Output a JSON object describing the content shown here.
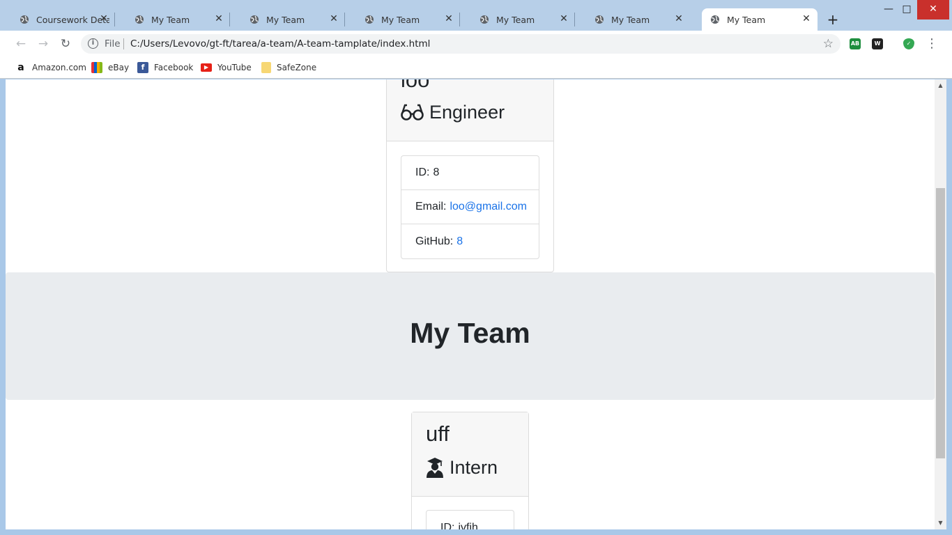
{
  "browser": {
    "tabs": [
      {
        "title": "Coursework Detail"
      },
      {
        "title": "My Team"
      },
      {
        "title": "My Team"
      },
      {
        "title": "My Team"
      },
      {
        "title": "My Team"
      },
      {
        "title": "My Team"
      },
      {
        "title": "My Team",
        "active": true
      }
    ],
    "new_tab": "+",
    "window_controls": {
      "minimize": "—",
      "maximize": "□",
      "close": "✕"
    },
    "address": {
      "scheme_label": "File",
      "url": "C:/Users/Levovo/gt-ft/tarea/a-team/A-team-tamplate/index.html"
    },
    "extensions": [
      {
        "name": "AB",
        "color": "#1e8e3e"
      },
      {
        "name": "W",
        "color": "#222222"
      },
      {
        "name": "✓",
        "color": "#34a853"
      }
    ],
    "bookmarks": [
      {
        "label": "Amazon.com",
        "icon": "amazon-icon"
      },
      {
        "label": "eBay",
        "icon": "ebay-icon"
      },
      {
        "label": "Facebook",
        "icon": "facebook-icon"
      },
      {
        "label": "YouTube",
        "icon": "youtube-icon"
      },
      {
        "label": "SafeZone",
        "icon": "folder-icon"
      }
    ]
  },
  "page": {
    "engineer_card": {
      "name": "loo",
      "role": "Engineer",
      "role_icon": "glasses-icon",
      "rows": [
        {
          "label": "ID:",
          "value": "8"
        },
        {
          "label": "Email:",
          "value": "loo@gmail.com"
        },
        {
          "label": "GitHub:",
          "value": "8"
        }
      ]
    },
    "jumbotron_title": "My Team",
    "intern_card": {
      "name": "uff",
      "role": "Intern",
      "role_icon": "graduate-icon",
      "rows": [
        {
          "label": "ID:",
          "value": "jvfjh"
        }
      ]
    }
  },
  "colors": {
    "link": "#1a73e8",
    "jumbotron_bg": "#e9ecef",
    "card_header_bg": "#f7f7f7"
  }
}
